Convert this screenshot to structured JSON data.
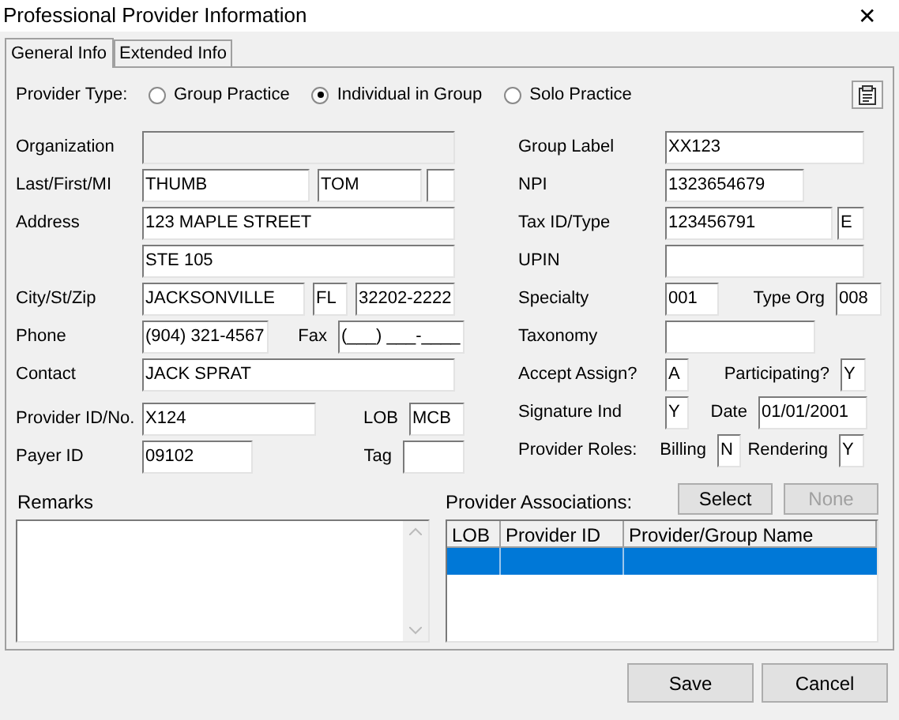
{
  "window": {
    "title": "Professional Provider Information",
    "close": "✕"
  },
  "tabs": [
    {
      "label": "General Info",
      "selected": true
    },
    {
      "label": "Extended Info",
      "selected": false
    }
  ],
  "provider_type": {
    "label": "Provider Type:",
    "options": [
      {
        "label": "Group Practice",
        "selected": false
      },
      {
        "label": "Individual in Group",
        "selected": true
      },
      {
        "label": "Solo Practice",
        "selected": false
      }
    ]
  },
  "left_rows": [
    {
      "items": [
        {
          "kind": "label",
          "text": "Organization"
        },
        {
          "kind": "field",
          "value": "",
          "disabled": true
        }
      ]
    },
    {
      "items": [
        {
          "kind": "label",
          "text": "Last/First/MI"
        },
        {
          "kind": "field",
          "value": "THUMB",
          "disabled": false
        },
        {
          "kind": "field",
          "value": "TOM",
          "disabled": false
        },
        {
          "kind": "field",
          "value": "",
          "disabled": false
        }
      ]
    },
    {
      "items": [
        {
          "kind": "label",
          "text": "Address"
        },
        {
          "kind": "field",
          "value": "123 MAPLE STREET",
          "disabled": false
        }
      ]
    },
    {
      "items": [
        {
          "kind": "spacer"
        },
        {
          "kind": "field",
          "value": "STE 105",
          "disabled": false
        }
      ]
    },
    {
      "items": [
        {
          "kind": "label",
          "text": "City/St/Zip"
        },
        {
          "kind": "field",
          "value": "JACKSONVILLE",
          "disabled": false
        },
        {
          "kind": "field",
          "value": "FL",
          "disabled": false
        },
        {
          "kind": "field",
          "value": "32202-2222",
          "disabled": false
        }
      ]
    },
    {
      "items": [
        {
          "kind": "label",
          "text": "Phone"
        },
        {
          "kind": "field",
          "value": "(904) 321-4567",
          "disabled": false
        },
        {
          "kind": "label",
          "text": "Fax"
        },
        {
          "kind": "field",
          "value": "(___) ___-____",
          "disabled": false
        }
      ]
    },
    {
      "items": [
        {
          "kind": "label",
          "text": "Contact"
        },
        {
          "kind": "field",
          "value": "JACK SPRAT",
          "disabled": false
        }
      ]
    },
    {
      "items": [
        {
          "kind": "label",
          "text": "Provider ID/No."
        },
        {
          "kind": "field",
          "value": "X124",
          "disabled": false
        },
        {
          "kind": "label",
          "text": "LOB"
        },
        {
          "kind": "field",
          "value": "MCB",
          "disabled": false
        }
      ]
    },
    {
      "items": [
        {
          "kind": "label",
          "text": "Payer ID"
        },
        {
          "kind": "field",
          "value": "09102",
          "disabled": false
        },
        {
          "kind": "label",
          "text": "Tag"
        },
        {
          "kind": "field",
          "value": "",
          "disabled": false
        }
      ]
    }
  ],
  "right_rows": [
    {
      "items": [
        {
          "kind": "label",
          "text": "Group Label"
        },
        {
          "kind": "field",
          "value": "XX123",
          "disabled": false
        }
      ]
    },
    {
      "items": [
        {
          "kind": "label",
          "text": "NPI"
        },
        {
          "kind": "field",
          "value": "1323654679",
          "disabled": false
        }
      ]
    },
    {
      "items": [
        {
          "kind": "label",
          "text": "Tax ID/Type"
        },
        {
          "kind": "field",
          "value": "123456791",
          "disabled": false
        },
        {
          "kind": "field",
          "value": "E",
          "disabled": false
        }
      ]
    },
    {
      "items": [
        {
          "kind": "label",
          "text": "UPIN"
        },
        {
          "kind": "field",
          "value": "",
          "disabled": false
        }
      ]
    },
    {
      "items": [
        {
          "kind": "label",
          "text": "Specialty"
        },
        {
          "kind": "field",
          "value": "001",
          "disabled": false
        },
        {
          "kind": "label",
          "text": "Type Org"
        },
        {
          "kind": "field",
          "value": "008",
          "disabled": false
        }
      ]
    },
    {
      "items": [
        {
          "kind": "label",
          "text": "Taxonomy"
        },
        {
          "kind": "field",
          "value": "",
          "disabled": false
        }
      ]
    },
    {
      "items": [
        {
          "kind": "label",
          "text": "Accept Assign?"
        },
        {
          "kind": "field",
          "value": "A",
          "disabled": false
        },
        {
          "kind": "label",
          "text": "Participating?"
        },
        {
          "kind": "field",
          "value": "Y",
          "disabled": false
        }
      ]
    },
    {
      "items": [
        {
          "kind": "label",
          "text": "Signature Ind"
        },
        {
          "kind": "field",
          "value": "Y",
          "disabled": false
        },
        {
          "kind": "label",
          "text": "Date"
        },
        {
          "kind": "field",
          "value": "01/01/2001",
          "disabled": false
        }
      ]
    },
    {
      "items": [
        {
          "kind": "label",
          "text": "Provider Roles:"
        },
        {
          "kind": "label",
          "text": "Billing"
        },
        {
          "kind": "field",
          "value": "N",
          "disabled": false
        },
        {
          "kind": "label",
          "text": "Rendering"
        },
        {
          "kind": "field",
          "value": "Y",
          "disabled": false
        }
      ]
    }
  ],
  "remarks": {
    "label": "Remarks"
  },
  "associations": {
    "label": "Provider Associations:",
    "buttons": [
      {
        "label": "Select",
        "disabled": false
      },
      {
        "label": "None",
        "disabled": true
      }
    ],
    "columns": [
      "LOB",
      "Provider ID",
      "Provider/Group Name"
    ],
    "rows": [
      {
        "selected": true
      }
    ]
  },
  "buttons": [
    {
      "label": "Save"
    },
    {
      "label": "Cancel"
    }
  ]
}
